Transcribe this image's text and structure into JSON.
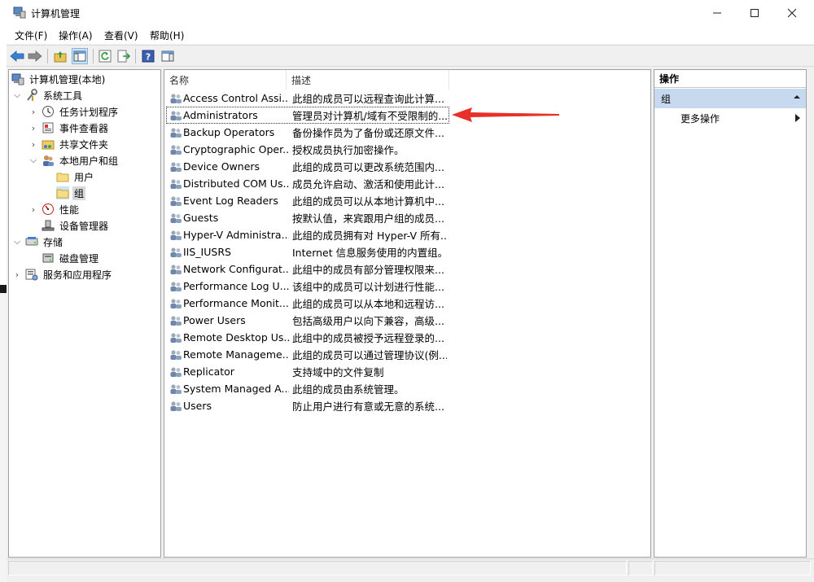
{
  "window": {
    "title": "计算机管理"
  },
  "menu": {
    "items": [
      "文件(F)",
      "操作(A)",
      "查看(V)",
      "帮助(H)"
    ]
  },
  "tree": {
    "root": "计算机管理(本地)",
    "system_tools": "系统工具",
    "task_scheduler": "任务计划程序",
    "event_viewer": "事件查看器",
    "shared_folders": "共享文件夹",
    "local_users_groups": "本地用户和组",
    "users": "用户",
    "groups": "组",
    "performance": "性能",
    "device_manager": "设备管理器",
    "storage": "存储",
    "disk_management": "磁盘管理",
    "services_apps": "服务和应用程序"
  },
  "list": {
    "columns": {
      "name": "名称",
      "description": "描述"
    },
    "rows": [
      {
        "name": "Access Control Assi...",
        "desc": "此组的成员可以远程查询此计算..."
      },
      {
        "name": "Administrators",
        "desc": "管理员对计算机/域有不受限制的..."
      },
      {
        "name": "Backup Operators",
        "desc": "备份操作员为了备份或还原文件..."
      },
      {
        "name": "Cryptographic Oper...",
        "desc": "授权成员执行加密操作。"
      },
      {
        "name": "Device Owners",
        "desc": "此组的成员可以更改系统范围内..."
      },
      {
        "name": "Distributed COM Us...",
        "desc": "成员允许启动、激活和使用此计..."
      },
      {
        "name": "Event Log Readers",
        "desc": "此组的成员可以从本地计算机中..."
      },
      {
        "name": "Guests",
        "desc": "按默认值，来宾跟用户组的成员..."
      },
      {
        "name": "Hyper-V Administra...",
        "desc": "此组的成员拥有对 Hyper-V 所有..."
      },
      {
        "name": "IIS_IUSRS",
        "desc": "Internet 信息服务使用的内置组。"
      },
      {
        "name": "Network Configurat...",
        "desc": "此组中的成员有部分管理权限来..."
      },
      {
        "name": "Performance Log U...",
        "desc": "该组中的成员可以计划进行性能..."
      },
      {
        "name": "Performance Monit...",
        "desc": "此组的成员可以从本地和远程访..."
      },
      {
        "name": "Power Users",
        "desc": "包括高级用户以向下兼容，高级..."
      },
      {
        "name": "Remote Desktop Us...",
        "desc": "此组中的成员被授予远程登录的..."
      },
      {
        "name": "Remote Manageme...",
        "desc": "此组的成员可以通过管理协议(例..."
      },
      {
        "name": "Replicator",
        "desc": "支持域中的文件复制"
      },
      {
        "name": "System Managed A...",
        "desc": "此组的成员由系统管理。"
      },
      {
        "name": "Users",
        "desc": "防止用户进行有意或无意的系统..."
      }
    ]
  },
  "actions": {
    "title": "操作",
    "group": "组",
    "more": "更多操作"
  },
  "colors": {
    "accent": "#cce4f7",
    "arrow": "#e8302a",
    "action_group_bg": "#c7d9ee"
  }
}
